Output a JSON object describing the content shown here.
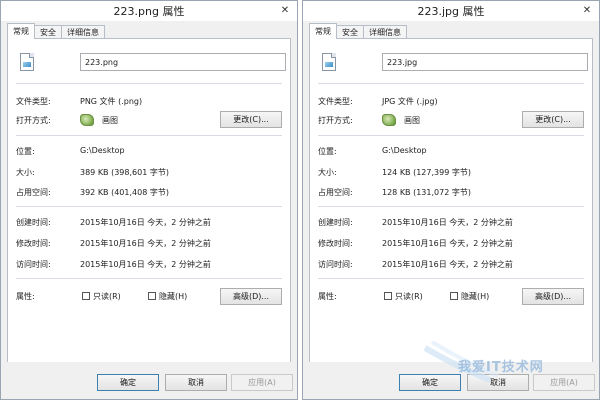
{
  "left": {
    "title": "223.png 属性",
    "tabs": [
      "常规",
      "安全",
      "详细信息"
    ],
    "filename": "223.png",
    "type_label": "文件类型:",
    "type_value": "PNG 文件 (.png)",
    "open_label": "打开方式:",
    "open_app": "画图",
    "change_button": "更改(C)...",
    "location_label": "位置:",
    "location_value": "G:\\Desktop",
    "size_label": "大小:",
    "size_value": "389 KB (398,601 字节)",
    "disk_label": "占用空间:",
    "disk_value": "392 KB (401,408 字节)",
    "created_label": "创建时间:",
    "created_value": "2015年10月16日 今天，2 分钟之前",
    "modified_label": "修改时间:",
    "modified_value": "2015年10月16日 今天，2 分钟之前",
    "accessed_label": "访问时间:",
    "accessed_value": "2015年10月16日 今天，2 分钟之前",
    "attrs_label": "属性:",
    "readonly_label": "只读(R)",
    "hidden_label": "隐藏(H)",
    "advanced_button": "高级(D)...",
    "ok_button": "确定",
    "cancel_button": "取消",
    "apply_button": "应用(A)"
  },
  "right": {
    "title": "223.jpg 属性",
    "tabs": [
      "常规",
      "安全",
      "详细信息"
    ],
    "filename": "223.jpg",
    "type_label": "文件类型:",
    "type_value": "JPG 文件 (.jpg)",
    "open_label": "打开方式:",
    "open_app": "画图",
    "change_button": "更改(C)...",
    "location_label": "位置:",
    "location_value": "G:\\Desktop",
    "size_label": "大小:",
    "size_value": "124 KB (127,399 字节)",
    "disk_label": "占用空间:",
    "disk_value": "128 KB (131,072 字节)",
    "created_label": "创建时间:",
    "created_value": "2015年10月16日 今天，2 分钟之前",
    "modified_label": "修改时间:",
    "modified_value": "2015年10月16日 今天，2 分钟之前",
    "accessed_label": "访问时间:",
    "accessed_value": "2015年10月16日 今天，2 分钟之前",
    "attrs_label": "属性:",
    "readonly_label": "只读(R)",
    "hidden_label": "隐藏(H)",
    "advanced_button": "高级(D)...",
    "ok_button": "确定",
    "cancel_button": "取消",
    "apply_button": "应用(A)"
  },
  "close_glyph": "✕",
  "watermark": "我爱IT技术网"
}
